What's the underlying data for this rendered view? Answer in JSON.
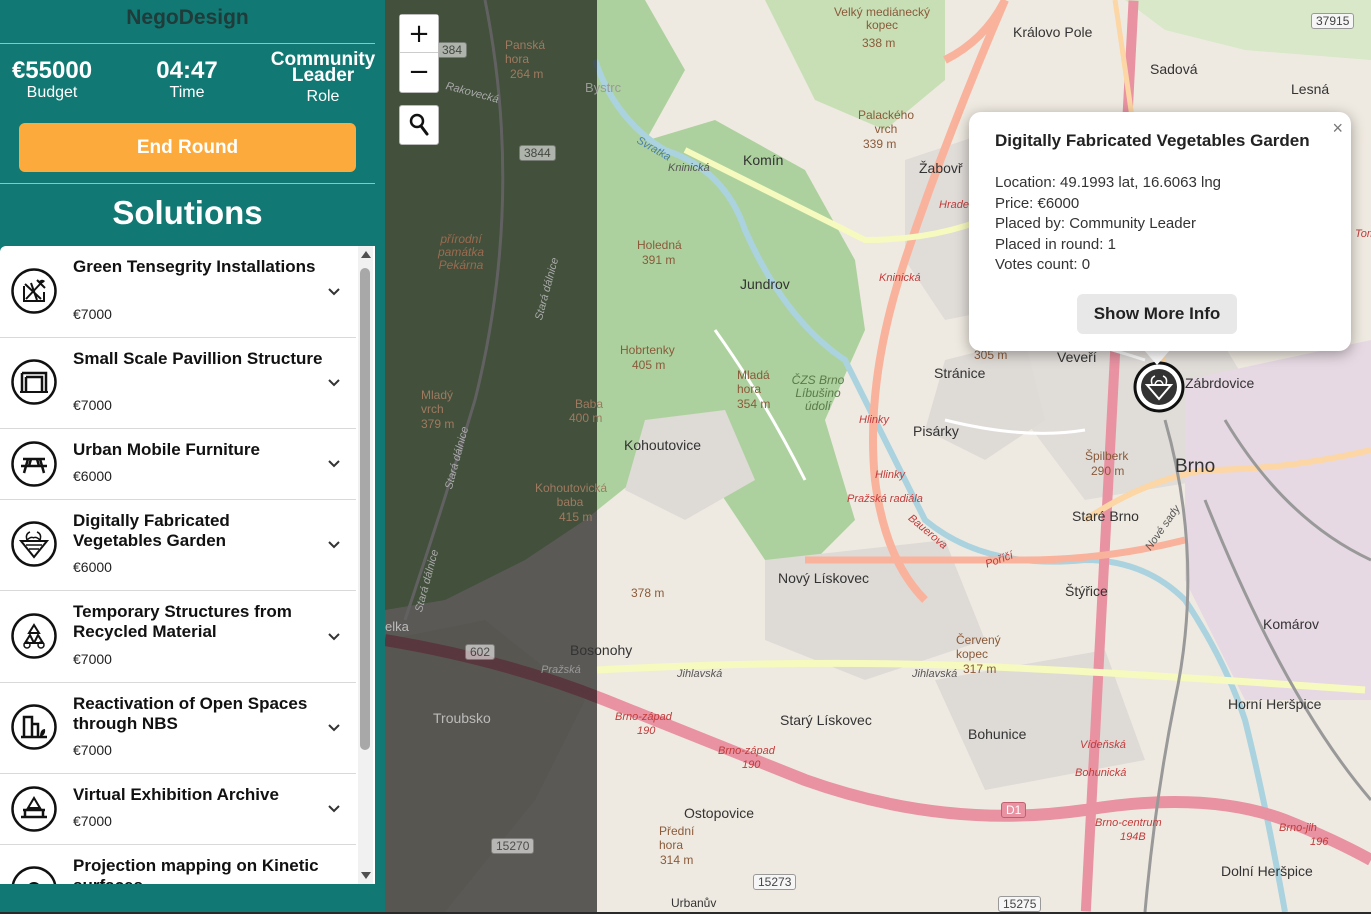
{
  "app": {
    "title": "NegoDesign"
  },
  "stats": {
    "budget": {
      "value": "€55000",
      "label": "Budget"
    },
    "time": {
      "value": "04:47",
      "label": "Time"
    },
    "role": {
      "value_line1": "Community",
      "value_line2": "Leader",
      "label": "Role"
    }
  },
  "end_round_label": "End Round",
  "solutions_heading": "Solutions",
  "solutions": [
    {
      "name": "Green Tensegrity Installations",
      "price": "€7000",
      "icon": "tensegrity-icon"
    },
    {
      "name": "Small Scale Pavillion Structure",
      "price": "€7000",
      "icon": "pavilion-icon"
    },
    {
      "name": "Urban Mobile Furniture",
      "price": "€6000",
      "icon": "picnic-table-icon"
    },
    {
      "name": "Digitally Fabricated Vegetables Garden",
      "price": "€6000",
      "icon": "vegetable-garden-icon"
    },
    {
      "name": "Temporary Structures from Recycled Material",
      "price": "€7000",
      "icon": "recycle-icon"
    },
    {
      "name": "Reactivation of Open Spaces through NBS",
      "price": "€7000",
      "icon": "buildings-nature-icon"
    },
    {
      "name": "Virtual Exhibition Archive",
      "price": "€7000",
      "icon": "exhibition-icon"
    },
    {
      "name": "Projection mapping on Kinetic surfaces",
      "price": "",
      "icon": "projection-icon"
    }
  ],
  "map": {
    "zoom_in": "+",
    "zoom_out": "−",
    "labels": {
      "kralovo_pole": "Královo Pole",
      "sadova": "Sadová",
      "lesna": "Lesná",
      "komin": "Komín",
      "zabovresky": "Žabovř",
      "jundrov": "Jundrov",
      "stranice": "Stránice",
      "veveri": "Veveří",
      "zabrdovice": "Zábrdovice",
      "pisarky": "Pisárky",
      "kohoutovice": "Kohoutovice",
      "brno": "Brno",
      "stare_brno": "Staré Brno",
      "styrice": "Štýřice",
      "novy_liskovec": "Nový Lískovec",
      "komarov": "Komárov",
      "bosonohy": "Bosonohy",
      "troubsko": "Troubsko",
      "stary_liskovec": "Starý Lískovec",
      "bohunice": "Bohunice",
      "horni_herspice": "Horní Heršpice",
      "ostopovice": "Ostopovice",
      "dolni_herspice": "Dolní Heršpice",
      "urbanov": "Urbanův",
      "bystrc": "Bystrc",
      "elka": "elka",
      "holedna": "Holedná",
      "holedna_h": "391 m",
      "hobrtenky": "Hobrtenky",
      "hobrtenky_h": "405 m",
      "mlada_hora": "Mladá hora",
      "mlada_hora_h": "354 m",
      "spilberk": "Špilberk",
      "spilberk_h": "290 m",
      "cerveny_kopec": "Červený kopec",
      "cerveny_kopec_h": "317 m",
      "velky_kopec": "Velký mediánecký kopec",
      "velky_kopec_h": "338 m",
      "palackeho": "Palackého vrch",
      "palackeho_h": "339 m",
      "panska": "Panská hora",
      "panska_h": "264 m",
      "mlady_vrch": "Mladý vrch",
      "mlady_vrch_h": "379 m",
      "baba": "Baba",
      "baba_h": "400 m",
      "kohoutovicka": "Kohoutovická baba",
      "kohoutovicka_h": "415 m",
      "predni_hora": "Přední hora",
      "predni_hora_h": "314 m",
      "h378": "378 m",
      "h305": "305 m",
      "prirodni": "přírodní památka Pekárna",
      "czs": "ČZS Brno Líbušino údolí",
      "kninicska": "Kninická",
      "kninicska2": "Kninická",
      "hlinky": "Hlinky",
      "hlinky2": "Hlinky",
      "prazska": "Pražská radiála",
      "jihlavska": "Jihlavská",
      "jihlavska2": "Jihlavská",
      "brno_zapad": "Brno-západ",
      "brno_zapad_n": "190",
      "brno_zapad2": "Brno-západ",
      "brno_zapad2_n": "190",
      "brno_centrum": "Brno-centrum",
      "brno_centrum_n": "194B",
      "brno_jih": "Brno-jih",
      "brno_jih_n": "196",
      "videnska": "Vídeňská",
      "bohunicka": "Bohunická",
      "porici": "Poříčí",
      "hradecka": "Hrade",
      "bauerova": "Bauerova",
      "svratka": "Svratka",
      "prazska_road": "Pražská",
      "tom": "Tom",
      "stara_dalnice": "Stará dálnice",
      "stara_dalnice2": "Stará dálnice",
      "stara_dalnice3": "Stará dálnice",
      "rakovecka": "Rakovecká",
      "nove_sady": "Nové sady",
      "d1": "D1"
    },
    "shields": {
      "s384": "384",
      "s3844": "3844",
      "s602": "602",
      "s15270": "15270",
      "s15273": "15273",
      "s15275": "15275",
      "s37915": "37915"
    }
  },
  "popup": {
    "title": "Digitally Fabricated Vegetables Garden",
    "location": "Location: 49.1993 lat, 16.6063 lng",
    "price": "Price: €6000",
    "placed_by": "Placed by: Community Leader",
    "placed_round": "Placed in round: 1",
    "votes": "Votes count: 0",
    "show_more": "Show More Info",
    "close": "×"
  },
  "colors": {
    "sidebar": "#127873",
    "accent": "#fcaa3c",
    "motorway": "#e892a2",
    "trunk": "#f9b29c",
    "forest": "#add19e"
  }
}
